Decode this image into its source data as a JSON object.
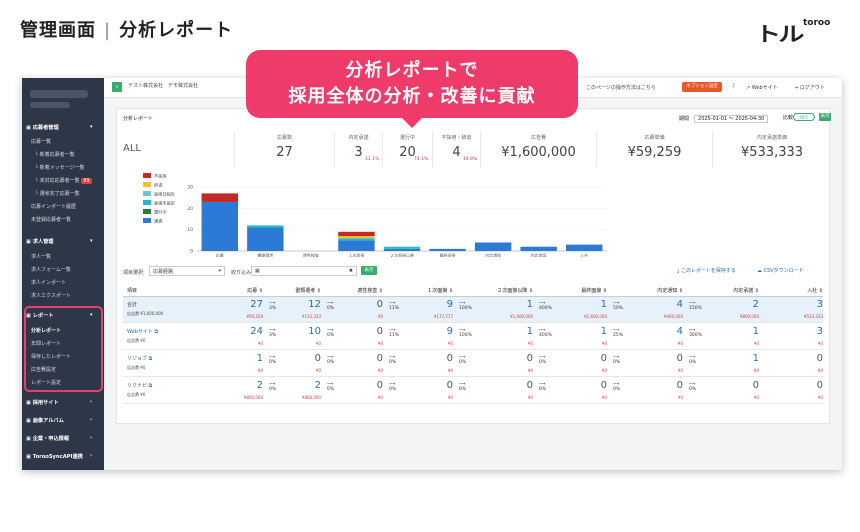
{
  "header": {
    "title_left": "管理画面",
    "title_right": "分析レポート",
    "logo_main": "トル",
    "logo_sub": "toroo"
  },
  "bubble": {
    "line1": "分析レポートで",
    "line2": "採用全体の分析・改善に貢献"
  },
  "topbar": {
    "company": "テスト株式会社　デモ株式会社",
    "help": "このページの操作方法はこちら",
    "option": "オプション設定",
    "website": "Webサイト",
    "logout": "ログアウト"
  },
  "sidebar": {
    "sections": [
      {
        "label": "応募者管理",
        "items": [
          "応募一覧",
          "└ 新着応募者一覧",
          "└ 新着メッセージ一覧",
          "└ 未対応応募者一覧",
          "└ 選考完了応募一覧",
          "応募インポート履歴",
          "未登録応募者一覧"
        ],
        "badge": "99"
      },
      {
        "label": "求人管理",
        "items": [
          "求人一覧",
          "求人フォーム一覧",
          "求人インポート",
          "求人エクスポート"
        ]
      },
      {
        "label": "レポート",
        "items": [
          "分析レポート",
          "年間レポート",
          "保存したレポート",
          "広告費設定",
          "レポート設定"
        ]
      },
      {
        "label": "採用サイト"
      },
      {
        "label": "画像アルバム"
      },
      {
        "label": "企業・申込情報"
      },
      {
        "label": "TorooSyncAPI連携"
      }
    ]
  },
  "report": {
    "title": "分析レポート",
    "period_label": "期間",
    "period": "2025-01-01 ～ 2025-04-30",
    "compare_label": "比較",
    "toggle": "OFF",
    "show": "表示",
    "kpis": [
      {
        "label": "",
        "value": "ALL",
        "pct": ""
      },
      {
        "label": "応募数",
        "value": "27",
        "pct": ""
      },
      {
        "label": "内定承諾",
        "value": "3",
        "pct": "11.1%"
      },
      {
        "label": "選行中",
        "value": "20",
        "pct": "74.1%"
      },
      {
        "label": "不採用・辞退",
        "value": "4",
        "pct": "14.8%"
      },
      {
        "label": "広告費",
        "value": "¥1,600,000",
        "pct": ""
      },
      {
        "label": "応募単価",
        "value": "¥59,259",
        "pct": ""
      },
      {
        "label": "内定承諾単価",
        "value": "¥533,333",
        "pct": ""
      }
    ],
    "toolbar": {
      "item_select": "項目選択:",
      "item_value": "応募経路",
      "filter": "絞り込み:",
      "show": "表示",
      "save": "このレポートを保存する",
      "csv": "CSVダウンロード"
    },
    "columns": [
      "項目",
      "応募",
      "書類選考",
      "適性検査",
      "１次面接",
      "２次面接以降",
      "最終面接",
      "内定通知",
      "内定承諾",
      "入社"
    ],
    "rows": [
      {
        "name": "合計",
        "ad": "広告費 ¥1,600,000",
        "vals": [
          "27",
          "12",
          "0",
          "9",
          "1",
          "1",
          "4",
          "2",
          "3"
        ],
        "subs": [
          "¥59,259",
          "¥133,333",
          "¥0",
          "¥177,777",
          "¥1,600,000",
          "¥1,600,000",
          "¥400,000",
          "¥800,000",
          "¥533,333"
        ],
        "pcts": [
          "3%",
          "0%",
          "11%",
          "100%",
          "400%",
          "50%",
          "150%"
        ]
      },
      {
        "name": "Webサイト",
        "ad": "広告費 ¥0",
        "vals": [
          "24",
          "10",
          "0",
          "9",
          "1",
          "1",
          "4",
          "1",
          "3"
        ],
        "subs": [
          "¥0",
          "¥0",
          "¥0",
          "¥0",
          "¥0",
          "¥0",
          "¥0",
          "¥0",
          "¥0"
        ],
        "pcts": [
          "3%",
          "0%",
          "11%",
          "100%",
          "400%",
          "25%",
          "300%"
        ]
      },
      {
        "name": "リジョブ",
        "ad": "広告費 ¥0",
        "vals": [
          "1",
          "0",
          "0",
          "0",
          "0",
          "0",
          "0",
          "1",
          "0"
        ],
        "subs": [
          "¥0",
          "¥0",
          "¥0",
          "¥0",
          "¥0",
          "¥0",
          "¥0",
          "¥0",
          "¥0"
        ],
        "pcts": [
          "0%",
          "0%",
          "0%",
          "0%",
          "0%",
          "0%",
          "0%"
        ]
      },
      {
        "name": "リクナビ",
        "ad": "広告費 ¥0",
        "vals": [
          "2",
          "2",
          "0",
          "0",
          "0",
          "0",
          "0",
          "0",
          "0"
        ],
        "subs": [
          "¥800,000",
          "¥800,000",
          "¥0",
          "¥0",
          "¥0",
          "¥0",
          "¥0",
          "¥0",
          "¥0"
        ],
        "pcts": [
          "0%",
          "0%",
          "0%",
          "0%",
          "0%",
          "0%",
          "0%"
        ]
      }
    ]
  },
  "chart_data": {
    "type": "bar",
    "categories": [
      "応募",
      "書類選考",
      "適性検査",
      "１次面接",
      "２次面接以降",
      "最終面接",
      "内定通知",
      "内定承諾",
      "入社"
    ],
    "ylim": [
      0,
      30
    ],
    "yticks": [
      0,
      10,
      20,
      30
    ],
    "series": [
      {
        "name": "通過",
        "color": "#2b7bd6",
        "values": [
          23,
          11,
          0,
          5,
          1,
          1,
          4,
          2,
          3
        ]
      },
      {
        "name": "選行中",
        "color": "#2a7a3a",
        "values": [
          0,
          0,
          0,
          0,
          0,
          0,
          0,
          0,
          0
        ]
      },
      {
        "name": "面接未設定",
        "color": "#26b9c9",
        "values": [
          0,
          1,
          0,
          1,
          1,
          0,
          0,
          0,
          0
        ]
      },
      {
        "name": "面接日程近",
        "color": "#6ec1d9",
        "values": [
          0,
          0,
          0,
          0,
          0,
          0,
          0,
          0,
          0
        ]
      },
      {
        "name": "辞退",
        "color": "#f1c232",
        "values": [
          0,
          0,
          0,
          1,
          0,
          0,
          0,
          0,
          0
        ]
      },
      {
        "name": "不採用",
        "color": "#c62828",
        "values": [
          4,
          0,
          0,
          2,
          0,
          0,
          0,
          0,
          0
        ]
      }
    ]
  }
}
